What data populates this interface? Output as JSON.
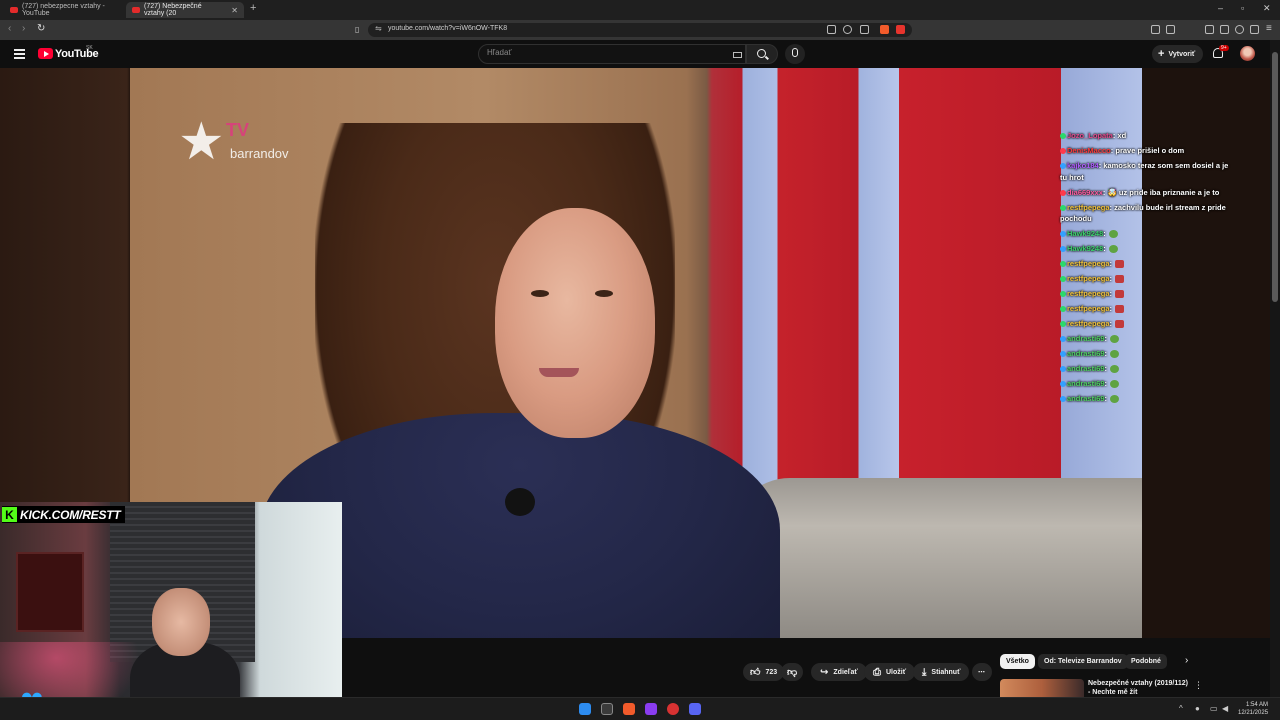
{
  "browser": {
    "tabs": [
      {
        "title": "(727) nebezpecne vztahy - YouTube",
        "active": false
      },
      {
        "title": "(727) Nebezpečné vztahy (20",
        "active": true
      }
    ],
    "url": "youtube.com/watch?v=iW6nOW-TFK8",
    "window_controls": [
      "–",
      "▫",
      "✕"
    ]
  },
  "youtube": {
    "logo_text": "YouTube",
    "region": "SK",
    "search_placeholder": "Hľadať",
    "create_label": "Vytvoriť",
    "notification_count": "9+"
  },
  "video": {
    "channel_logo_tv": "TV",
    "channel_logo_name": "barrandov"
  },
  "overlay": {
    "kick_label": "KICK.COM/RESTT",
    "chat": [
      {
        "user": "Jozo_Lopata",
        "text": ": xd",
        "badge": "g",
        "color": "#e24a8c"
      },
      {
        "user": "DenisMacco",
        "text": ": prave prišiel o dom",
        "badge": "b3",
        "color": "#ff3a3a"
      },
      {
        "user": "kajko184",
        "text": ": kamosko teraz som sem dosiel a je tu hrot",
        "badge": "b2",
        "color": "#b05cff"
      },
      {
        "user": "dia669xxx",
        "text": ": 🤯 uz pride iba priznanie a je to",
        "badge": "b3",
        "color": "#ff5ca0"
      },
      {
        "user": "restfpepega",
        "text": ": zachvilu bude irl stream z pride pochodu",
        "badge": "g",
        "color": "#f0c23a"
      },
      {
        "user": "Hawk9248",
        "text": ":",
        "badge": "b2",
        "color": "#3ad06b",
        "emote": "g"
      },
      {
        "user": "Hawk9248",
        "text": ":",
        "badge": "b2",
        "color": "#3ad06b",
        "emote": "g"
      },
      {
        "user": "restfpepega",
        "text": ":",
        "badge": "g",
        "color": "#f0c23a",
        "emote": "r"
      },
      {
        "user": "restfpepega",
        "text": ":",
        "badge": "g",
        "color": "#f0c23a",
        "emote": "r"
      },
      {
        "user": "restfpepega",
        "text": ":",
        "badge": "g",
        "color": "#f0c23a",
        "emote": "r"
      },
      {
        "user": "restfpepega",
        "text": ":",
        "badge": "g",
        "color": "#f0c23a",
        "emote": "r"
      },
      {
        "user": "restfpepega",
        "text": ":",
        "badge": "g",
        "color": "#f0c23a",
        "emote": "r"
      },
      {
        "user": "andrasti69",
        "text": ":",
        "badge": "b2",
        "color": "#4fd162",
        "emote": "g"
      },
      {
        "user": "andrasti69",
        "text": ":",
        "badge": "b2",
        "color": "#4fd162",
        "emote": "g"
      },
      {
        "user": "andrasti69",
        "text": ":",
        "badge": "b2",
        "color": "#4fd162",
        "emote": "g"
      },
      {
        "user": "andrasti69",
        "text": ":",
        "badge": "b2",
        "color": "#4fd162",
        "emote": "g"
      },
      {
        "user": "andrasti69",
        "text": ":",
        "badge": "b2",
        "color": "#4fd162",
        "emote": "g"
      }
    ]
  },
  "actions": {
    "like_count": "723",
    "share_label": "Zdieľať",
    "save_label": "Uložiť",
    "download_label": "Stiahnuť",
    "more": "⋯"
  },
  "related": {
    "chips": [
      "Všetko",
      "Od: Televize Barrandov",
      "Podobné"
    ],
    "first_title": "Nebezpečné vztahy (2019/112) - Nechte mě žít"
  },
  "taskbar": {
    "time": "1:54 AM",
    "date": "12/21/2025"
  }
}
